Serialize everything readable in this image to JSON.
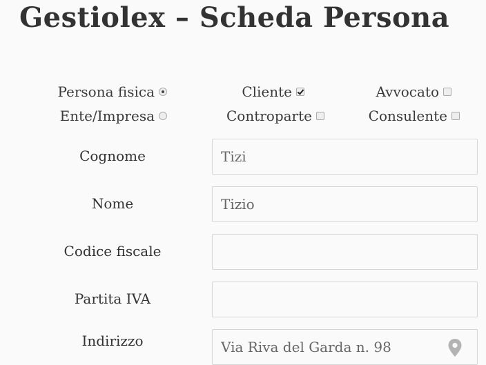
{
  "title": "Gestiolex – Scheda Persona",
  "type_options": {
    "persona_fisica": {
      "label": "Persona fisica",
      "selected": true
    },
    "ente_impresa": {
      "label": "Ente/Impresa",
      "selected": false
    }
  },
  "role_options": {
    "cliente": {
      "label": "Cliente",
      "checked": true
    },
    "controparte": {
      "label": "Controparte",
      "checked": false
    },
    "avvocato": {
      "label": "Avvocato",
      "checked": false
    },
    "consulente": {
      "label": "Consulente",
      "checked": false
    }
  },
  "fields": {
    "cognome": {
      "label": "Cognome",
      "value": "Tizi"
    },
    "nome": {
      "label": "Nome",
      "value": "Tizio"
    },
    "codice_fiscale": {
      "label": "Codice fiscale",
      "value": ""
    },
    "partita_iva": {
      "label": "Partita IVA",
      "value": ""
    },
    "indirizzo": {
      "label": "Indirizzo",
      "value": "Via Riva del Garda n. 98",
      "icon": "map-pin-icon"
    }
  }
}
